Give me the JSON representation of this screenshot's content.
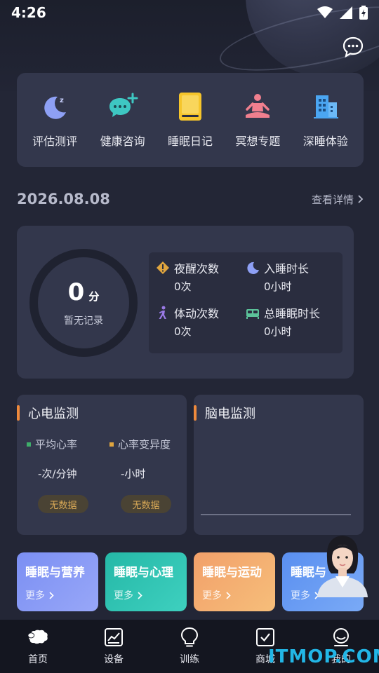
{
  "status": {
    "time": "4:26"
  },
  "quick_actions": [
    {
      "label": "评估测评",
      "icon": "moon-icon"
    },
    {
      "label": "健康咨询",
      "icon": "chat-plus-icon"
    },
    {
      "label": "睡眠日记",
      "icon": "diary-icon"
    },
    {
      "label": "冥想专题",
      "icon": "meditation-icon"
    },
    {
      "label": "深睡体验",
      "icon": "building-icon"
    }
  ],
  "date_row": {
    "date": "2026.08.08",
    "details_label": "查看详情"
  },
  "score": {
    "value": "0",
    "unit": "分",
    "note": "暂无记录"
  },
  "stats": [
    {
      "label": "夜醒次数",
      "value": "0次",
      "icon": "warning-icon"
    },
    {
      "label": "入睡时长",
      "value": "0小时",
      "icon": "moon-icon"
    },
    {
      "label": "体动次数",
      "value": "0次",
      "icon": "movement-icon"
    },
    {
      "label": "总睡眠时长",
      "value": "0小时",
      "icon": "bed-icon"
    }
  ],
  "ecg": {
    "title": "心电监测",
    "avg_hr_label": "平均心率",
    "hrv_label": "心率变异度",
    "avg_hr_value": "-次/分钟",
    "hrv_value": "-小时",
    "no_data": "无数据",
    "colors": {
      "avg_hr": "#3fae6a",
      "hrv": "#e0a53e"
    }
  },
  "eeg": {
    "title": "脑电监测"
  },
  "topics": [
    {
      "title": "睡眠与营养",
      "more": "更多"
    },
    {
      "title": "睡眠与心理",
      "more": "更多"
    },
    {
      "title": "睡眠与运动",
      "more": "更多"
    },
    {
      "title": "睡眠与",
      "more": "更多"
    }
  ],
  "tabs": [
    {
      "label": "首页"
    },
    {
      "label": "设备"
    },
    {
      "label": "训练"
    },
    {
      "label": "商城"
    },
    {
      "label": "我的"
    }
  ],
  "watermark": "ITMOP.COM",
  "colors": {
    "accent": "#ef8a3c",
    "card": "#33374c",
    "background": "#232636"
  }
}
